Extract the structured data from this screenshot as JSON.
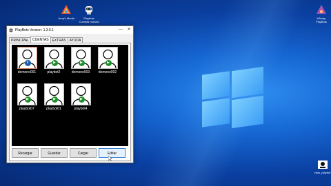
{
  "desktop": {
    "icons": [
      {
        "label": "Jerry's Media",
        "icon": "app-shortcut-icon"
      },
      {
        "label": "Playbots Cuentas nuevas",
        "icon": "robot-shortcut-icon"
      },
      {
        "label": "bRemp PlayBots",
        "icon": "app-shortcut-icon"
      },
      {
        "label": "virus_playbot",
        "icon": "file-shortcut-icon"
      }
    ]
  },
  "window": {
    "title": "PlayBots Version: 1.3.0.1",
    "minimize": "—",
    "close": "✕",
    "tabs": [
      {
        "label": "PRINCIPAL",
        "active": false
      },
      {
        "label": "CUENTAS",
        "active": true
      },
      {
        "label": "EXTRAS",
        "active": false
      },
      {
        "label": "AYUDA",
        "active": false
      }
    ],
    "accounts": [
      {
        "name": "demono001",
        "status": "paused",
        "status_glyph": "II"
      },
      {
        "name": "playbot2",
        "status": "play",
        "status_glyph": "▶"
      },
      {
        "name": "demono003",
        "status": "play",
        "status_glyph": "▶"
      },
      {
        "name": "demono002",
        "status": "play",
        "status_glyph": "▶"
      },
      {
        "name": "playbot07",
        "status": "play",
        "status_glyph": "▶"
      },
      {
        "name": "playbot01",
        "status": "play",
        "status_glyph": "▶"
      },
      {
        "name": "playbot4",
        "status": "play",
        "status_glyph": "▶"
      }
    ],
    "buttons": [
      {
        "label": "Recargar"
      },
      {
        "label": "Guardar"
      },
      {
        "label": "Cargar"
      },
      {
        "label": "Editar"
      }
    ]
  },
  "colors": {
    "play": "#1e8f2a",
    "pause": "#1f5fa8",
    "desktop_blue": "#1667d3"
  }
}
